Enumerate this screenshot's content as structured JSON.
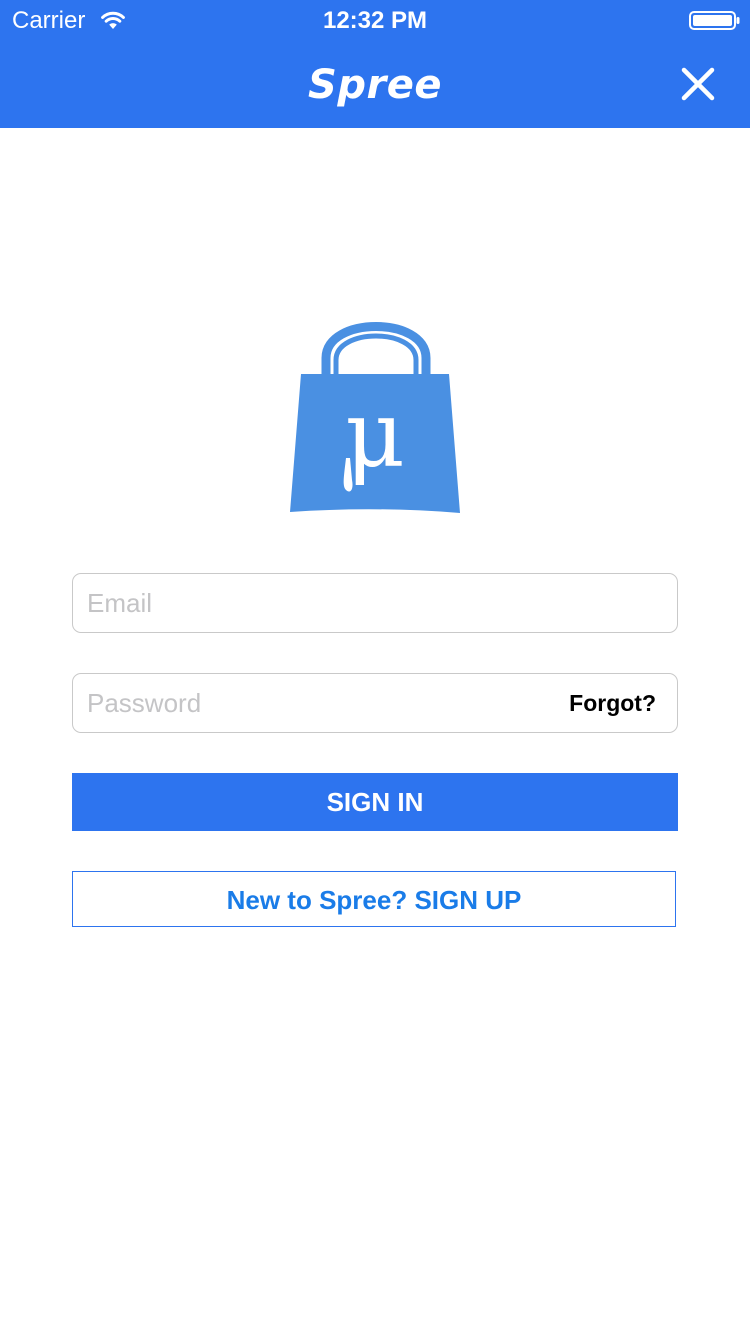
{
  "status_bar": {
    "carrier": "Carrier",
    "time": "12:32 PM",
    "wifi_icon": "wifi-icon",
    "battery_icon": "battery-icon"
  },
  "nav": {
    "title": "Spree",
    "close_icon": "close-icon"
  },
  "logo": {
    "icon": "shopping-bag-mu-logo",
    "glyph": "μ"
  },
  "form": {
    "email_placeholder": "Email",
    "email_value": "",
    "password_placeholder": "Password",
    "password_value": "",
    "forgot_label": "Forgot?",
    "signin_label": "SIGN IN",
    "signup_label": "New to Spree? SIGN UP"
  },
  "colors": {
    "brand_blue": "#2d74ef",
    "logo_blue": "#4a90e2",
    "link_blue": "#1a7ce8",
    "placeholder_gray": "#c4c4c6",
    "border_gray": "#c9c9c9"
  }
}
